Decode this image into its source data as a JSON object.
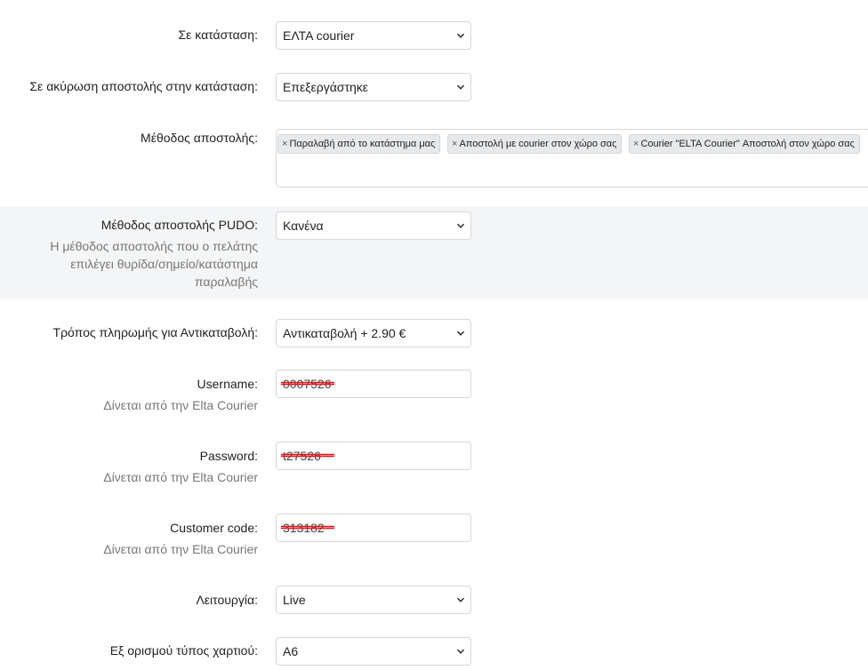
{
  "fields": {
    "status": {
      "label": "Σε κατάσταση:",
      "value": "ΕΛΤΑ courier"
    },
    "cancel_status": {
      "label": "Σε ακύρωση αποστολής στην κατάσταση:",
      "value": "Επεξεργάστηκε"
    },
    "shipping_method": {
      "label": "Μέθοδος αποστολής:",
      "tags": [
        "Παραλαβή από το κατάστημα μας",
        "Αποστολή με courier στον χώρο σας",
        "Courier \"ELTA Courier\" Αποστολή στον χώρο σας"
      ],
      "remove_symbol": "×"
    },
    "pudo": {
      "label": "Μέθοδος αποστολής PUDO:",
      "hint_lines": [
        "Η μέθοδος αποστολής που ο πελάτης",
        "επιλέγει θυρίδα/σημείο/κατάστημα",
        "παραλαβής"
      ],
      "value": "Κανένα"
    },
    "cod_payment": {
      "label": "Τρόπος πληρωμής για Αντικαταβολή:",
      "value": "Αντικαταβολή + 2.90 €"
    },
    "username": {
      "label": "Username:",
      "hint": "Δίνεται από την Elta Courier",
      "value": "0007526"
    },
    "password": {
      "label": "Password:",
      "hint": "Δίνεται από την Elta Courier",
      "value": "t27526"
    },
    "customer_code": {
      "label": "Customer code:",
      "hint": "Δίνεται από την Elta Courier",
      "value": "313182"
    },
    "mode": {
      "label": "Λειτουργία:",
      "value": "Live"
    },
    "paper": {
      "label": "Εξ ορισμού τύπος χαρτιού:",
      "value": "A6"
    }
  },
  "icons": {
    "select_arrow": "chevron-down-icon"
  },
  "colors": {
    "redaction": "#e0191f",
    "band": "#f4f5f6",
    "border": "#d5d7db",
    "hint": "#777777"
  }
}
